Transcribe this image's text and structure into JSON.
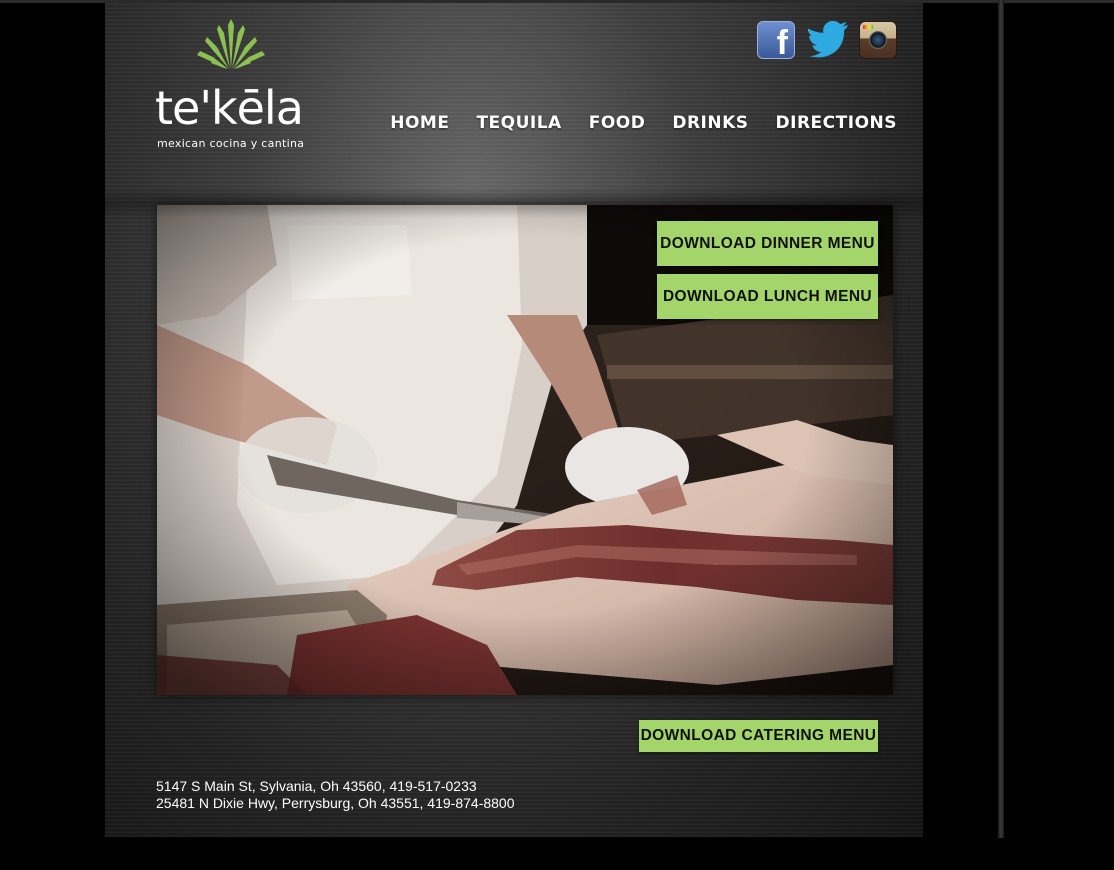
{
  "brand": {
    "name": "te'kēla",
    "tagline": "mexican cocina y cantina",
    "logo_icon": "agave-icon",
    "accent_color": "#a3d56a"
  },
  "social": [
    {
      "name": "Facebook",
      "icon": "facebook-icon"
    },
    {
      "name": "Twitter",
      "icon": "twitter-icon"
    },
    {
      "name": "Instagram",
      "icon": "instagram-icon"
    }
  ],
  "nav": {
    "items": [
      {
        "label": "HOME"
      },
      {
        "label": "TEQUILA"
      },
      {
        "label": "FOOD"
      },
      {
        "label": "DRINKS"
      },
      {
        "label": "DIRECTIONS"
      }
    ]
  },
  "hero": {
    "image": "chef-slicing-meat-photo"
  },
  "menus": {
    "dinner_label": "DOWNLOAD DINNER MENU",
    "lunch_label": "DOWNLOAD LUNCH MENU",
    "catering_label": "DOWNLOAD CATERING MENU"
  },
  "footer": {
    "addresses": [
      "5147 S Main St, Sylvania, Oh 43560, 419-517-0233",
      "25481 N Dixie Hwy, Perrysburg, Oh 43551, 419-874-8800"
    ]
  }
}
